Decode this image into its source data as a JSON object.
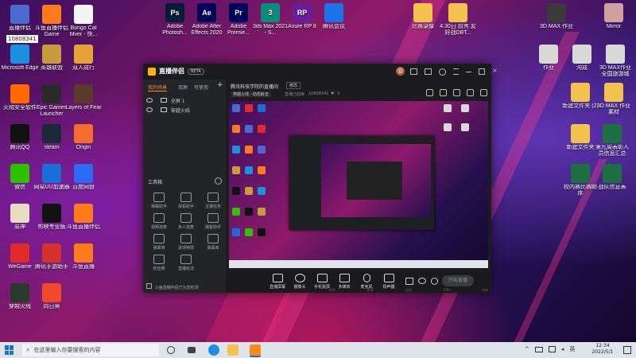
{
  "desktop": {
    "watermark": "10808341",
    "left_icons": [
      {
        "label": "直播伴侣",
        "color": "#4a6ad0"
      },
      {
        "label": "斗鱼直播伴侣Game",
        "color": "#ff7a1a"
      },
      {
        "label": "Bongo Cat Mver - 快...",
        "color": "#f4f4f4"
      },
      {
        "label": "Microsoft Edge",
        "color": "#1d8fe0"
      },
      {
        "label": "英雄联盟",
        "color": "#c89b3c"
      },
      {
        "label": "双人成行",
        "color": "#e8a23a"
      },
      {
        "label": "火绒安全软件",
        "color": "#ff6a00"
      },
      {
        "label": "Epic Games Launcher",
        "color": "#2a2a2a"
      },
      {
        "label": "Layers of Fear",
        "color": "#5a3a2a"
      },
      {
        "label": "腾讯QQ",
        "color": "#111111"
      },
      {
        "label": "steam",
        "color": "#1b2838"
      },
      {
        "label": "Origin",
        "color": "#f56c2d"
      },
      {
        "label": "微信",
        "color": "#2dc100"
      },
      {
        "label": "网易UU加速器",
        "color": "#1a6fd6"
      },
      {
        "label": "百度网盘",
        "color": "#2a6cf5"
      },
      {
        "label": "原神",
        "color": "#e9dcc0"
      },
      {
        "label": "剪映专业版",
        "color": "#111111"
      },
      {
        "label": "斗鱼直播伴侣",
        "color": "#ff7a1a"
      },
      {
        "label": "WeGame",
        "color": "#e02b2b"
      },
      {
        "label": "腾讯手游助手",
        "color": "#d4302c"
      },
      {
        "label": "斗鱼直播",
        "color": "#ff7a1a"
      },
      {
        "label": "穿越火线",
        "color": "#2a3a2a"
      },
      {
        "label": "向日葵",
        "color": "#f04a2a"
      }
    ],
    "top_icons": [
      {
        "label": "Adobe Photosh...",
        "color": "#001e36",
        "glyph": "Ps"
      },
      {
        "label": "Adobe After Effects 2020",
        "color": "#00005b",
        "glyph": "Ae"
      },
      {
        "label": "Adobe Premie...",
        "color": "#00005b",
        "glyph": "Pr"
      },
      {
        "label": "3ds Max 2021 - S...",
        "color": "#0e8a7a",
        "glyph": "3"
      },
      {
        "label": "Axure RP 8",
        "color": "#6a1b9a",
        "glyph": "RP"
      },
      {
        "label": "腾讯会议",
        "color": "#1a73e8",
        "glyph": ""
      }
    ],
    "right_icons": [
      {
        "label": "比赛录像",
        "color": "#f2c14e"
      },
      {
        "label": "4.30日 前秀 友好战DBT...",
        "color": "#f2c14e"
      },
      {
        "label": "3D MAX 作业",
        "color": "#3a3a3a"
      },
      {
        "label": "Mirror",
        "color": "#d0a0a0"
      },
      {
        "label": "作业",
        "color": "#d8d8d8"
      },
      {
        "label": "沟成",
        "color": "#d8d8d8"
      },
      {
        "label": "3D MAX作业 全国旅游城",
        "color": "#d8d8d8"
      },
      {
        "label": "新建文件夹 (2)",
        "color": "#f2c14e"
      },
      {
        "label": "3D MAX 作业素材",
        "color": "#f2c14e"
      },
      {
        "label": "新建文件夹",
        "color": "#f2c14e"
      },
      {
        "label": "第九周表彰人员信息汇总",
        "color": "#1d6f42"
      },
      {
        "label": "校内赛比赛顺序",
        "color": "#1d6f42"
      },
      {
        "label": "战队信息表",
        "color": "#1d6f42"
      }
    ]
  },
  "app": {
    "logo": "直播伴侣",
    "badge": "BETA",
    "avatar_letter": "@",
    "tabs": [
      "我的场景",
      "双屏",
      "可使用"
    ],
    "add_symbol": "+",
    "scenes": [
      "全屏 1",
      "穿越火线"
    ],
    "stream_title": "腾讯科技学院的直播间",
    "edit_label": "修改",
    "category": "穿越火线 · 动态射击",
    "room_label": "直播已结束",
    "room_id": "10808341",
    "likes": "0",
    "toolbox_label": "工具箱",
    "tools": [
      "弹幕助手",
      "观看助手",
      "主播任务",
      "视频连麦",
      "多人连麦",
      "播客助手",
      "弹幕墙",
      "进场特效",
      "弹幕库",
      "粉丝牌",
      "直播玩法"
    ],
    "footer_notice": "斗鱼直播伴侣已为您检测",
    "controls": [
      "直播屏幕",
      "摄像头",
      "手机投屏",
      "多媒体",
      "麦克风",
      "扬声器"
    ],
    "start_button": "开始直播",
    "stats": [
      "帧率",
      "码率",
      "丢帧",
      "CPU",
      "内存"
    ]
  },
  "taskbar": {
    "search_placeholder": "在这里输入你要搜索的内容",
    "time": "12:34",
    "date": "2022/5/1",
    "lang": "英"
  }
}
